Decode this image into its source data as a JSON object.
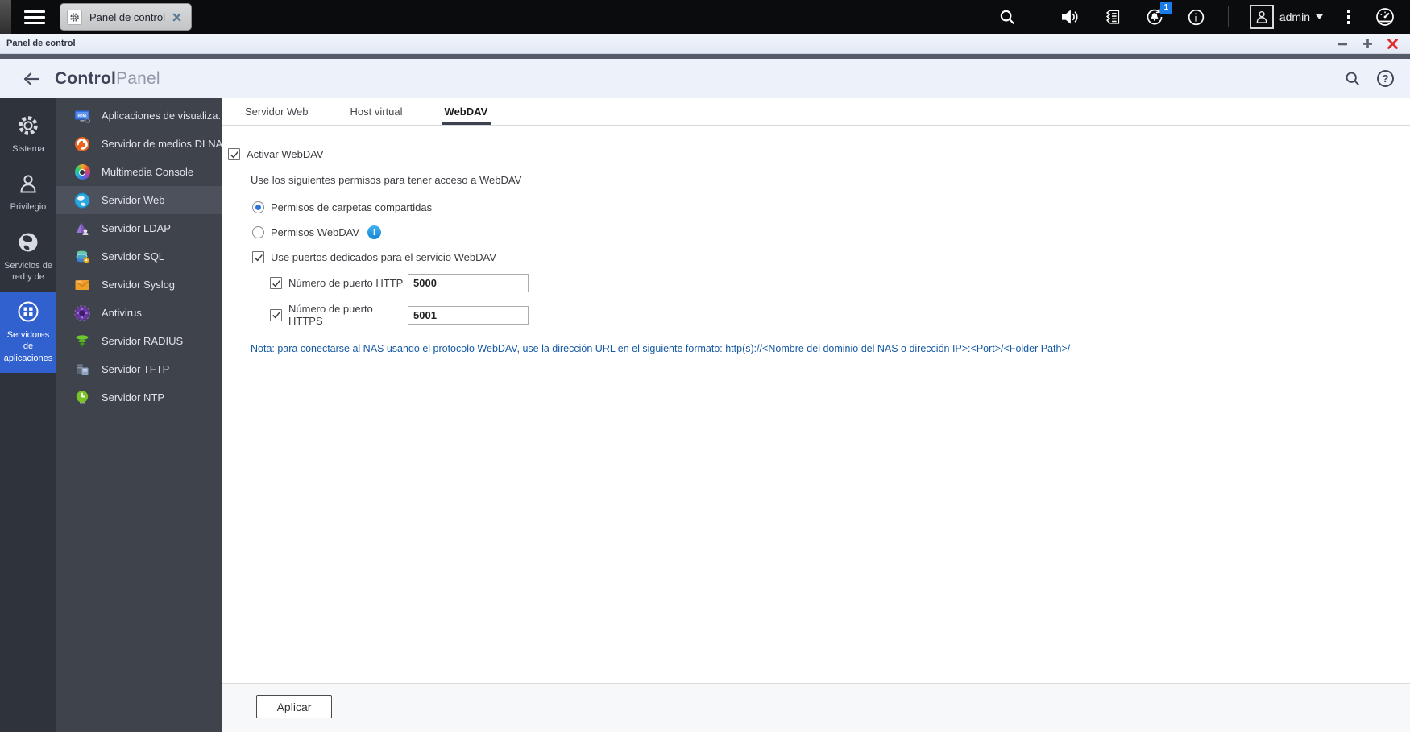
{
  "topbar": {
    "tab_label": "Panel de control",
    "user": "admin",
    "notification_badge": "1"
  },
  "titlebar": {
    "title": "Panel de control"
  },
  "header": {
    "title_bold": "Control",
    "title_light": "Panel"
  },
  "sidebar": {
    "sections": [
      {
        "label": "Sistema",
        "icon": "gear",
        "selected": false
      },
      {
        "label": "Privilegio",
        "icon": "user",
        "selected": false
      },
      {
        "label": "Servicios de red y de",
        "icon": "globe",
        "selected": false
      },
      {
        "label": "Servidores de aplicaciones",
        "icon": "apps-grid",
        "selected": true
      }
    ]
  },
  "apps": [
    {
      "label": "Aplicaciones de visualiza...",
      "icon": "hdmi-display",
      "selected": false
    },
    {
      "label": "Servidor de medios DLNA",
      "icon": "dlna",
      "selected": false
    },
    {
      "label": "Multimedia Console",
      "icon": "multimedia",
      "selected": false
    },
    {
      "label": "Servidor Web",
      "icon": "web-globe",
      "selected": true
    },
    {
      "label": "Servidor LDAP",
      "icon": "ldap",
      "selected": false
    },
    {
      "label": "Servidor SQL",
      "icon": "sql-database",
      "selected": false
    },
    {
      "label": "Servidor Syslog",
      "icon": "syslog",
      "selected": false
    },
    {
      "label": "Antivirus",
      "icon": "antivirus",
      "selected": false
    },
    {
      "label": "Servidor RADIUS",
      "icon": "radius",
      "selected": false
    },
    {
      "label": "Servidor TFTP",
      "icon": "tftp",
      "selected": false
    },
    {
      "label": "Servidor NTP",
      "icon": "ntp-clock",
      "selected": false
    }
  ],
  "tabs": [
    {
      "label": "Servidor Web",
      "active": false
    },
    {
      "label": "Host virtual",
      "active": false
    },
    {
      "label": "WebDAV",
      "active": true
    }
  ],
  "form": {
    "enable_webdav": {
      "label": "Activar WebDAV",
      "checked": true
    },
    "permissions_intro": "Use los siguientes permisos para tener acceso a WebDAV",
    "radio_shared_folders": {
      "label": "Permisos de carpetas compartidas",
      "selected": true
    },
    "radio_webdav_perms": {
      "label": "Permisos WebDAV",
      "selected": false
    },
    "dedicated_ports": {
      "label": "Use puertos dedicados para el servicio WebDAV",
      "checked": true
    },
    "http_port": {
      "label": "Número de puerto HTTP",
      "checked": true,
      "value": "5000"
    },
    "https_port": {
      "label": "Número de puerto HTTPS",
      "checked": true,
      "value": "5001"
    },
    "note": "Nota: para conectarse al NAS usando el protocolo WebDAV, use la dirección URL en el siguiente formato: http(s)://<Nombre del dominio del NAS o dirección IP>:<Port>/<Folder Path>/"
  },
  "footer": {
    "apply_label": "Aplicar"
  },
  "colors": {
    "accent_blue": "#3161cf",
    "note_blue": "#1559a4",
    "badge_blue": "#1a7ce8",
    "close_red": "#e12b2b",
    "rail_bg": "#2f333b",
    "applist_bg": "#3f434c"
  }
}
